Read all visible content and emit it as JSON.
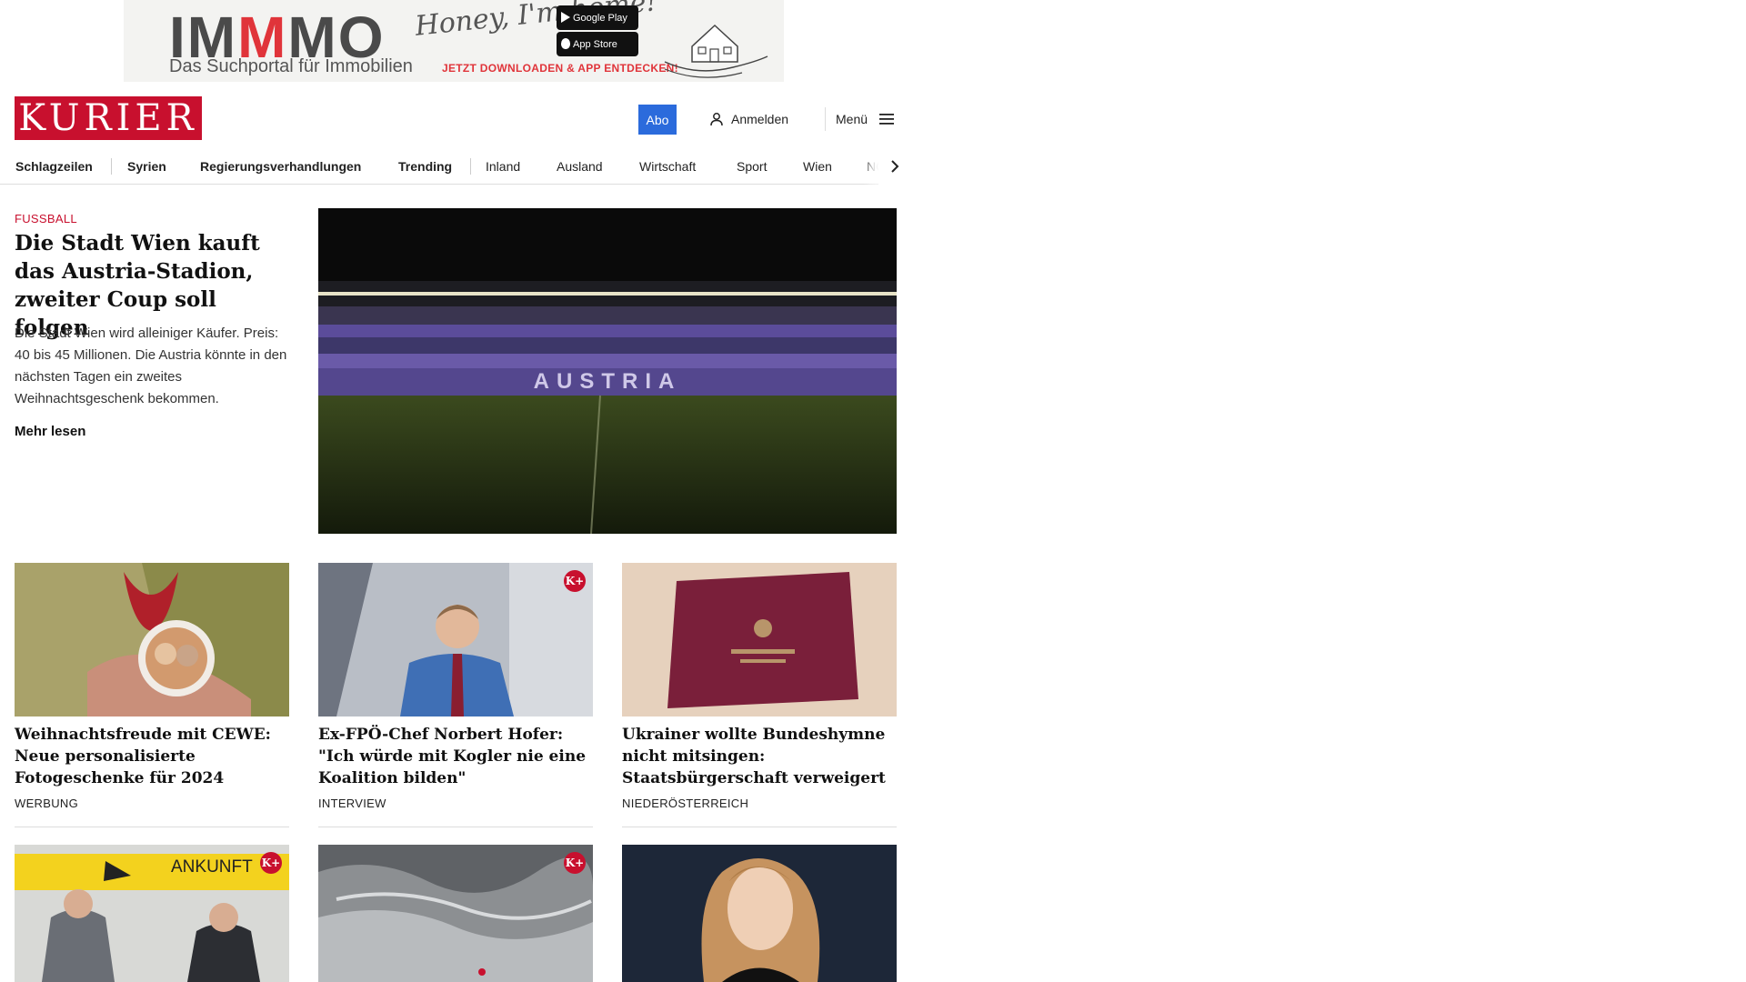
{
  "ad": {
    "brand_a": "IM",
    "brand_m": "M",
    "brand_b": "MO",
    "subtitle": "Das Suchportal für Immobilien",
    "script": "Honey, I'm home!",
    "google_play": "Google Play",
    "app_store": "App Store",
    "cta": "JETZT DOWNLOADEN & APP ENTDECKEN!"
  },
  "header": {
    "logo": "KURIER",
    "abo": "Abo",
    "login": "Anmelden",
    "menu": "Menü"
  },
  "nav": {
    "items": [
      "Schlagzeilen",
      "Syrien",
      "Regierungsverhandlungen",
      "Trending",
      "Inland",
      "Ausland",
      "Wirtschaft",
      "Sport",
      "Wien",
      "NÖ"
    ]
  },
  "lead": {
    "kicker": "FUSSBALL",
    "title": "Die Stadt Wien kauft das Austria-Stadion, zweiter Coup soll folgen",
    "text": "Die Stadt Wien wird alleiniger Käufer. Preis: 40 bis 45 Millionen. Die Austria könnte in den nächsten Tagen ein zweites Weihnachtsgeschenk bekommen.",
    "more": "Mehr lesen",
    "stadium_letters": "AUSTRIA"
  },
  "cards": [
    {
      "title": "Weihnachtsfreude mit CEWE: Neue personalisierte Fotogeschenke für 2024",
      "kicker": "WERBUNG",
      "premium": false
    },
    {
      "title": "Ex-FPÖ-Chef Norbert Hofer: \"Ich würde mit Kogler nie eine Koalition bilden\"",
      "kicker": "INTERVIEW",
      "premium": true
    },
    {
      "title": "Ukrainer wollte Bundeshymne nicht mitsingen: Staatsbürgerschaft verweigert",
      "kicker": "NIEDERÖSTERREICH",
      "premium": false
    }
  ],
  "row2": {
    "sign": "ANKUNFT"
  },
  "premium_badge": "K+",
  "colors": {
    "brand_red": "#c8102e",
    "abo_blue": "#2b6bdc"
  }
}
